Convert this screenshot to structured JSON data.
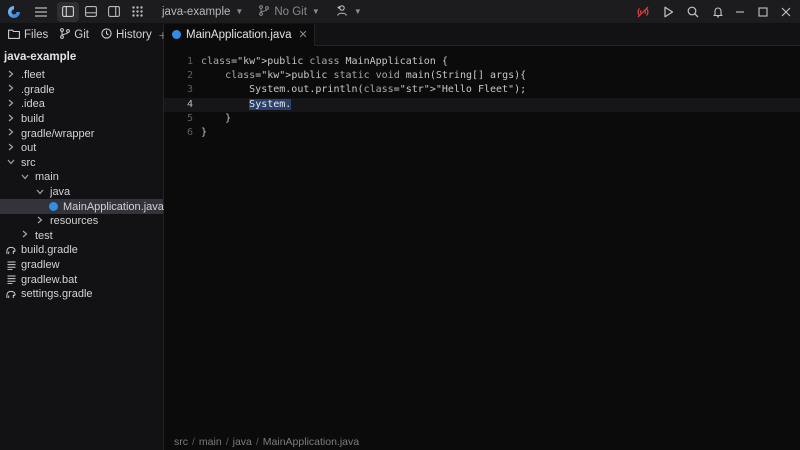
{
  "titlebar": {
    "project_label": "java-example",
    "git_label": "No Git"
  },
  "sidebar": {
    "tabs": [
      {
        "label": "Files"
      },
      {
        "label": "Git"
      },
      {
        "label": "History"
      }
    ],
    "project_title": "java-example",
    "tree": [
      {
        "label": ".fleet",
        "arrow": ">",
        "type": "folder"
      },
      {
        "label": ".gradle",
        "arrow": ">",
        "type": "folder"
      },
      {
        "label": ".idea",
        "arrow": ">",
        "type": "folder"
      },
      {
        "label": "build",
        "arrow": ">",
        "type": "folder"
      },
      {
        "label": "gradle/wrapper",
        "arrow": ">",
        "type": "folder"
      },
      {
        "label": "out",
        "arrow": ">",
        "type": "folder"
      },
      {
        "label": "src",
        "arrow": "v",
        "type": "folder"
      },
      {
        "label": "main",
        "arrow": "v",
        "type": "folder"
      },
      {
        "label": "java",
        "arrow": "v",
        "type": "folder"
      },
      {
        "label": "MainApplication.java",
        "type": "java-file",
        "selected": true
      },
      {
        "label": "resources",
        "arrow": ">",
        "type": "folder"
      },
      {
        "label": "test",
        "arrow": ">",
        "type": "folder"
      },
      {
        "label": "build.gradle",
        "type": "gradle-file"
      },
      {
        "label": "gradlew",
        "type": "text-file"
      },
      {
        "label": "gradlew.bat",
        "type": "text-file"
      },
      {
        "label": "settings.gradle",
        "type": "gradle-file"
      }
    ]
  },
  "editor": {
    "tab_label": "MainApplication.java",
    "current_line": 4,
    "lines": [
      {
        "num": "1",
        "code": "public class MainApplication {"
      },
      {
        "num": "2",
        "code": "    public static void main(String[] args){"
      },
      {
        "num": "3",
        "code": "        System.out.println(\"Hello Fleet\");"
      },
      {
        "num": "4",
        "code": "        System."
      },
      {
        "num": "5",
        "code": "    }"
      },
      {
        "num": "6",
        "code": "}"
      }
    ]
  },
  "breadcrumb": [
    "src",
    "main",
    "java",
    "MainApplication.java"
  ],
  "colors": {
    "accent": "#2f8ee6",
    "string": "#e08ce6",
    "selection": "#27416b",
    "broadcast_icon": "#e0443c"
  }
}
